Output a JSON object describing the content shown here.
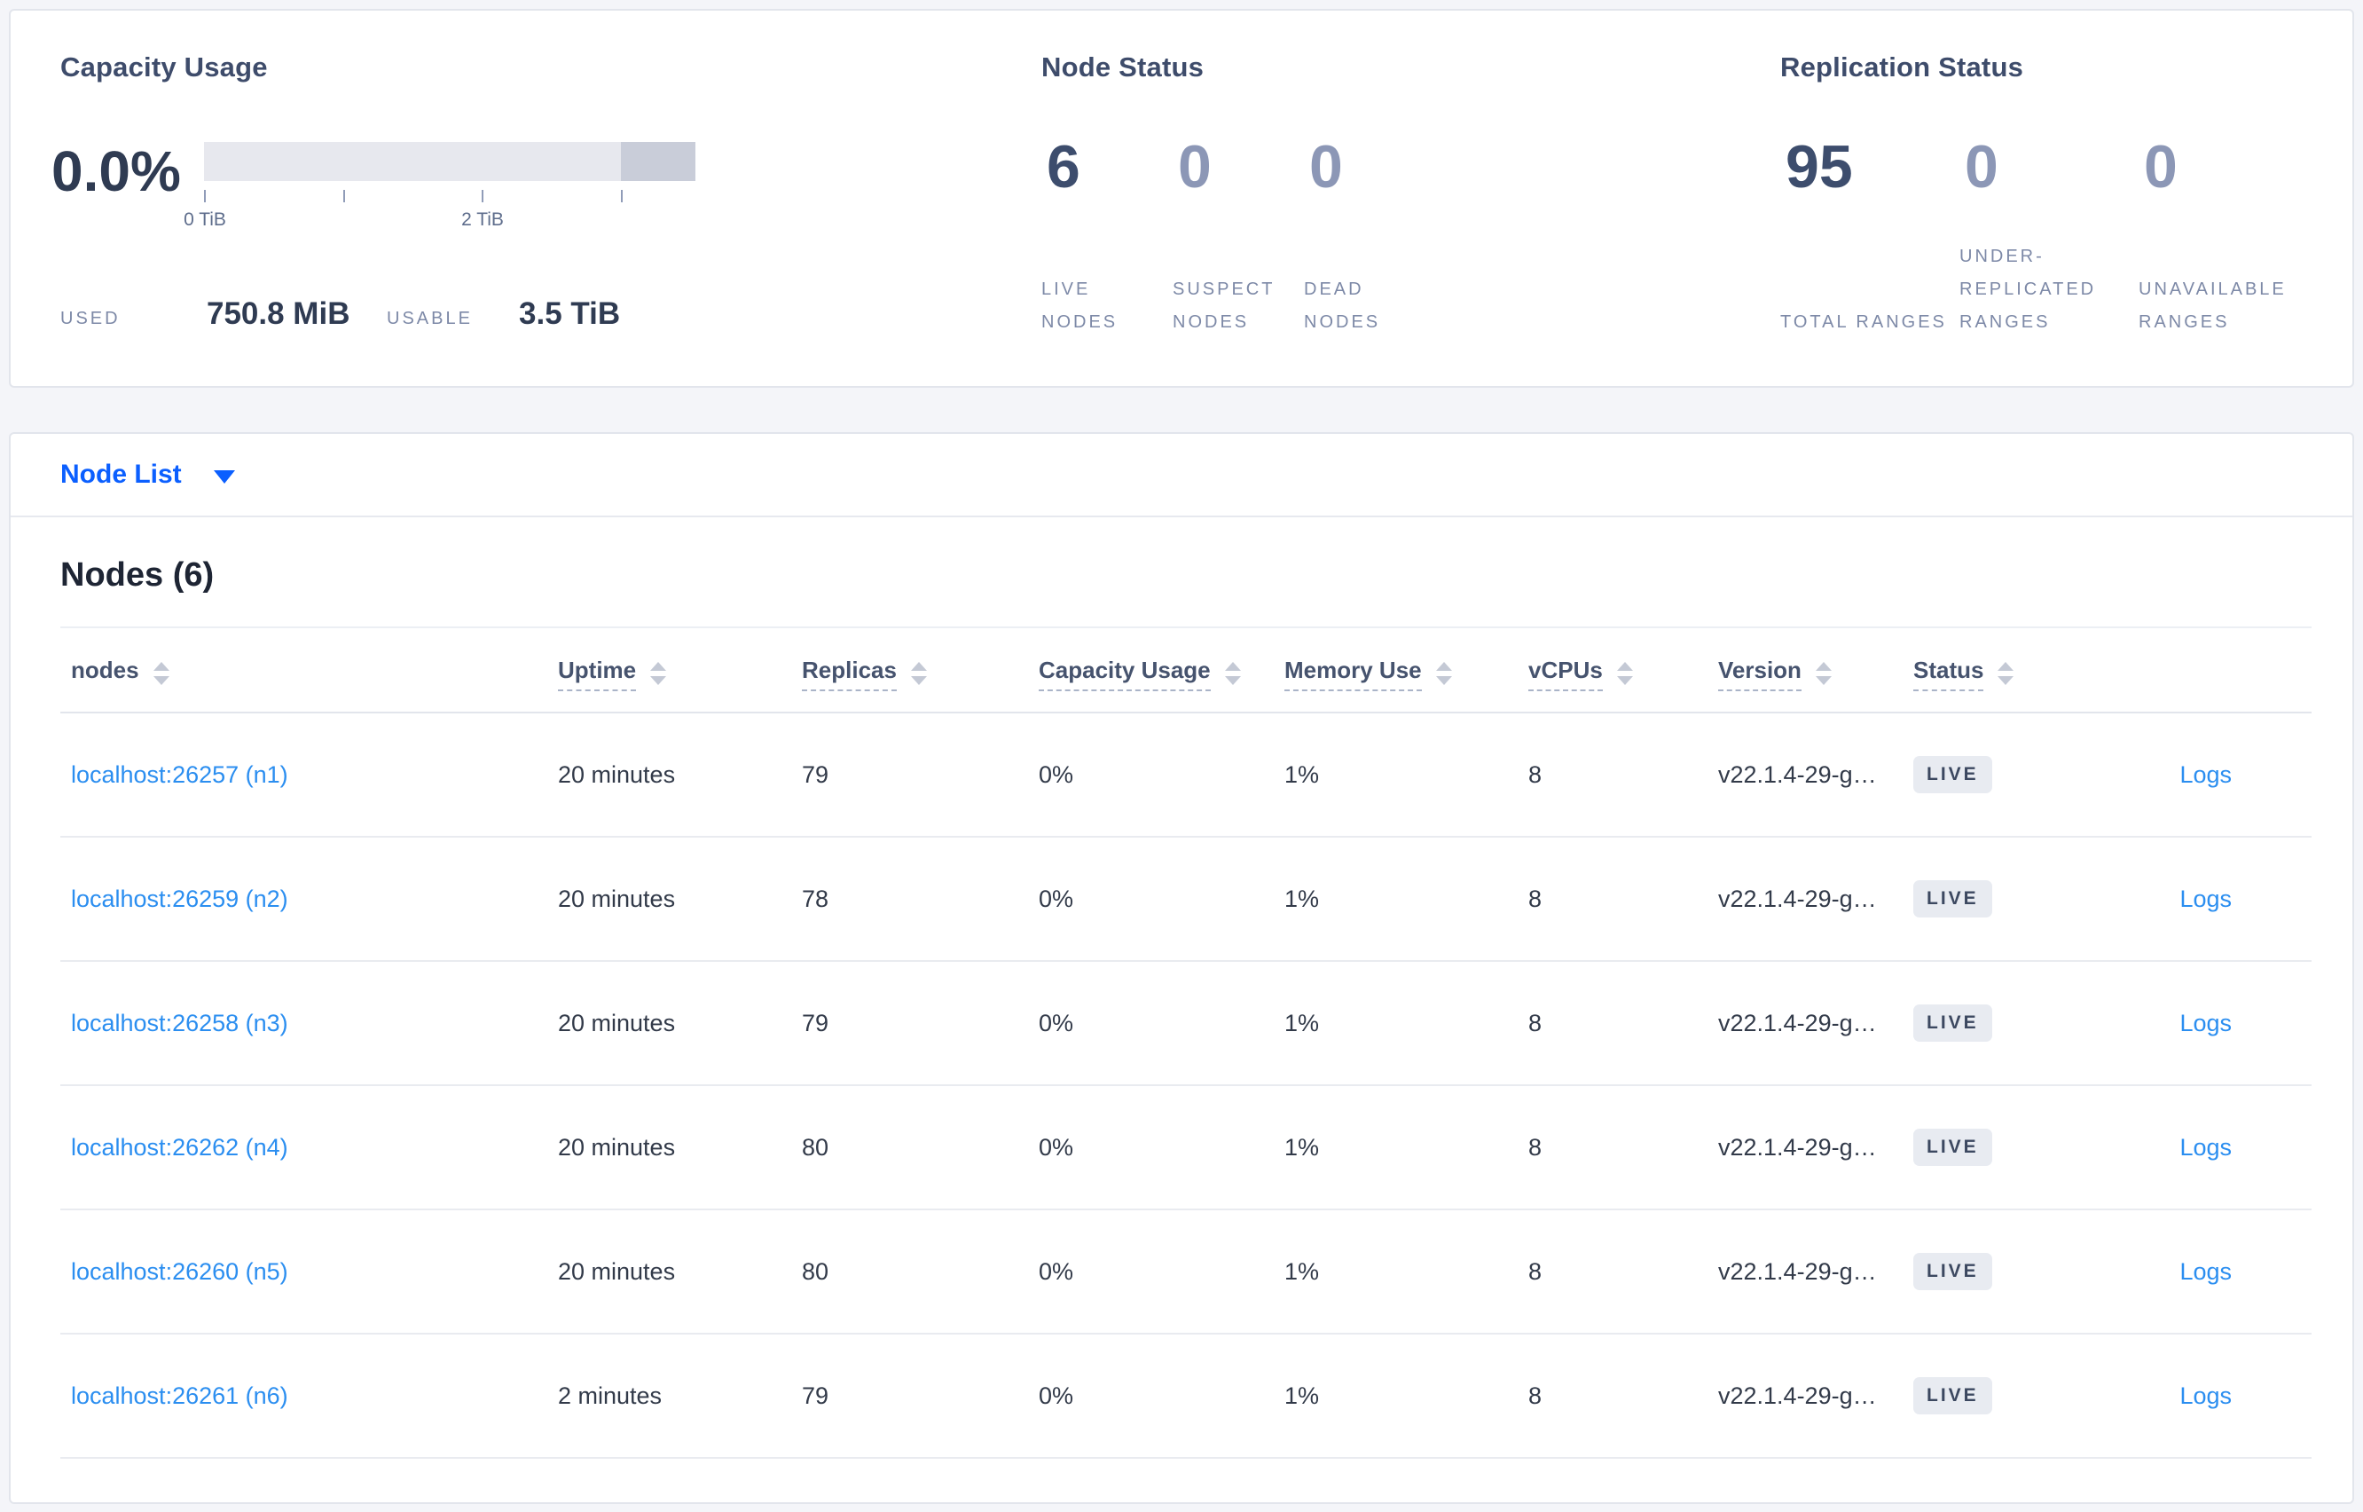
{
  "capacity": {
    "title": "Capacity Usage",
    "percent": "0.0%",
    "bar": {
      "track_color": "#e7e8ee",
      "segment_color": "#c9cdd9",
      "tick_positions_tib": [
        0,
        1,
        2,
        3
      ],
      "max_tib": 3.5
    },
    "tick_labels": {
      "first": "0 TiB",
      "third": "2 TiB"
    },
    "used_label": "USED",
    "used_value": "750.8 MiB",
    "usable_label": "USABLE",
    "usable_value": "3.5 TiB"
  },
  "node_status": {
    "title": "Node Status",
    "stats": [
      {
        "value": "6",
        "label": "LIVE NODES"
      },
      {
        "value": "0",
        "label": "SUSPECT NODES"
      },
      {
        "value": "0",
        "label": "DEAD NODES"
      }
    ]
  },
  "replication_status": {
    "title": "Replication Status",
    "stats": [
      {
        "value": "95",
        "label": "TOTAL RANGES"
      },
      {
        "value": "0",
        "label": "UNDER-REPLICATED RANGES"
      },
      {
        "value": "0",
        "label": "UNAVAILABLE RANGES"
      }
    ]
  },
  "node_list": {
    "label": "Node List"
  },
  "nodes_table": {
    "title": "Nodes (6)",
    "columns": [
      {
        "label": "nodes"
      },
      {
        "label": "Uptime"
      },
      {
        "label": "Replicas"
      },
      {
        "label": "Capacity Usage"
      },
      {
        "label": "Memory Use"
      },
      {
        "label": "vCPUs"
      },
      {
        "label": "Version"
      },
      {
        "label": "Status"
      }
    ],
    "rows": [
      {
        "node": "localhost:26257 (n1)",
        "uptime": "20 minutes",
        "replicas": "79",
        "capacity": "0%",
        "memory": "1%",
        "vcpus": "8",
        "version": "v22.1.4-29-g…",
        "status": "LIVE",
        "logs": "Logs"
      },
      {
        "node": "localhost:26259 (n2)",
        "uptime": "20 minutes",
        "replicas": "78",
        "capacity": "0%",
        "memory": "1%",
        "vcpus": "8",
        "version": "v22.1.4-29-g…",
        "status": "LIVE",
        "logs": "Logs"
      },
      {
        "node": "localhost:26258 (n3)",
        "uptime": "20 minutes",
        "replicas": "79",
        "capacity": "0%",
        "memory": "1%",
        "vcpus": "8",
        "version": "v22.1.4-29-g…",
        "status": "LIVE",
        "logs": "Logs"
      },
      {
        "node": "localhost:26262 (n4)",
        "uptime": "20 minutes",
        "replicas": "80",
        "capacity": "0%",
        "memory": "1%",
        "vcpus": "8",
        "version": "v22.1.4-29-g…",
        "status": "LIVE",
        "logs": "Logs"
      },
      {
        "node": "localhost:26260 (n5)",
        "uptime": "20 minutes",
        "replicas": "80",
        "capacity": "0%",
        "memory": "1%",
        "vcpus": "8",
        "version": "v22.1.4-29-g…",
        "status": "LIVE",
        "logs": "Logs"
      },
      {
        "node": "localhost:26261 (n6)",
        "uptime": "2 minutes",
        "replicas": "79",
        "capacity": "0%",
        "memory": "1%",
        "vcpus": "8",
        "version": "v22.1.4-29-g…",
        "status": "LIVE",
        "logs": "Logs"
      }
    ]
  },
  "colors": {
    "page_background": "#f4f5f9",
    "accent_blue": "#0b5fff",
    "link_blue": "#2b8ef0",
    "number_emphasis": "#3d4d6d",
    "number_dim": "#8c97b6",
    "badge_background": "#e8ebf1"
  }
}
